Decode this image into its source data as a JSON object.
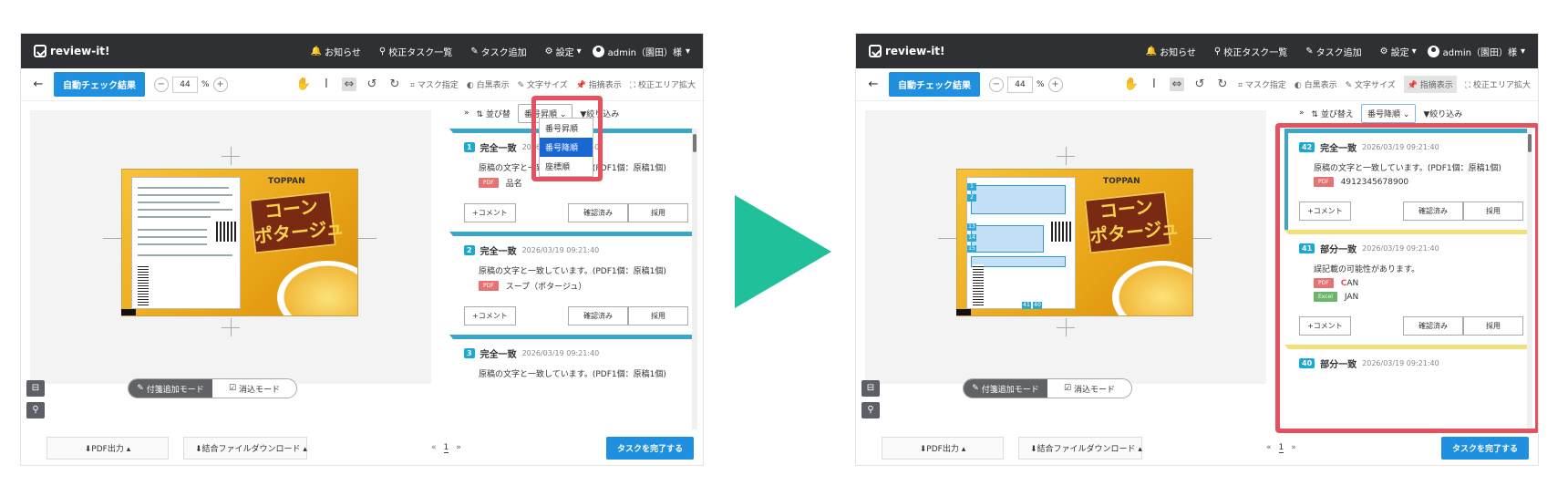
{
  "app": {
    "title": "review-it!"
  },
  "nav": {
    "notice": "お知らせ",
    "task_list": "校正タスク一覧",
    "add_task": "タスク追加",
    "settings": "設定",
    "user": "admin（園田）様"
  },
  "toolbar": {
    "auto_check": "自動チェック結果",
    "zoom_minus": "−",
    "zoom_value": "44",
    "zoom_unit": "%",
    "zoom_plus": "+",
    "mask": "マスク指定",
    "white": "白黒表示",
    "font_size": "文字サイズ",
    "pointer": "指摘表示",
    "expand": "校正エリア拡大"
  },
  "product": {
    "brand": "TOPPAN",
    "title": "コーン\nポタージュ"
  },
  "mode": {
    "add": "付箋追加モード",
    "erase": "消込モード"
  },
  "bottom": {
    "pdf": "PDF出力",
    "merge": "結合ファイルダウンロード",
    "prev": "«",
    "page": "1",
    "next": "»",
    "complete": "タスクを完了する"
  },
  "sortbar": {
    "expand": "»",
    "sort": "並び替え",
    "sort_left_trunc": "並び替",
    "sort_value_left": "番号昇順",
    "sort_value_right": "番号降順",
    "filter": "絞り込み"
  },
  "dropdown": {
    "items": [
      "番号昇順",
      "番号降順",
      "座標順"
    ]
  },
  "left_cards": [
    {
      "num": "1",
      "status": "完全一致",
      "date": "2026/03/19 09:21:40",
      "msg": "原稿の文字と一致しています。(PDF1個：原稿1個)",
      "src_tag": "PDF",
      "src": "品名"
    },
    {
      "num": "2",
      "status": "完全一致",
      "date": "2026/03/19 09:21:40",
      "msg": "原稿の文字と一致しています。(PDF1個：原稿1個)",
      "src_tag": "PDF",
      "src": "スープ（ポタージュ）"
    },
    {
      "num": "3",
      "status": "完全一致",
      "date": "2026/03/19 09:21:40",
      "msg": "原稿の文字と一致しています。(PDF1個：原稿1個)"
    }
  ],
  "right_cards": [
    {
      "num": "42",
      "status": "完全一致",
      "date": "2026/03/19 09:21:40",
      "msg": "原稿の文字と一致しています。(PDF1個：原稿1個)",
      "src_tag": "PDF",
      "src": "4912345678900"
    },
    {
      "num": "41",
      "status": "部分一致",
      "date": "2026/03/19 09:21:40",
      "msg": "誤記載の可能性があります。",
      "src_tag": "PDF",
      "src_hl": "C",
      "src_rest": "AN",
      "excel_tag": "Excel",
      "excel_src": "JAN"
    },
    {
      "num": "40",
      "status": "部分一致",
      "date": "2026/03/19 09:21:40"
    }
  ],
  "card_actions": {
    "comment": "+コメント",
    "confirm": "確認済み",
    "adopt": "採用"
  },
  "colors": {
    "accent": "#1f8fe0",
    "highlight": "#e5515c",
    "arrow": "#1fc09a"
  }
}
